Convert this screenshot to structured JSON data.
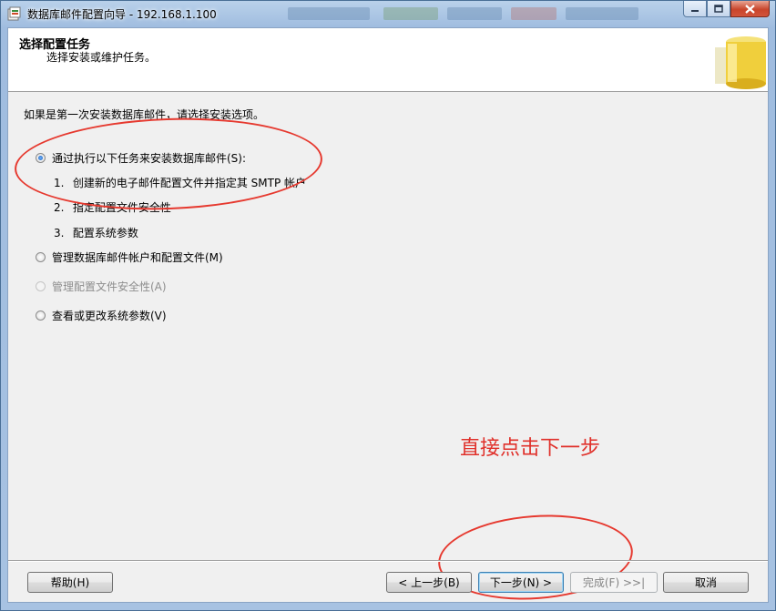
{
  "window": {
    "title": "数据库邮件配置向导 - 192.168.1.100"
  },
  "header": {
    "title": "选择配置任务",
    "subtitle": "选择安装或维护任务。"
  },
  "main": {
    "intro": "如果是第一次安装数据库邮件，请选择安装选项。",
    "options": [
      {
        "label": "通过执行以下任务来安装数据库邮件(S):",
        "checked": true,
        "enabled": true
      },
      {
        "label": "管理数据库邮件帐户和配置文件(M)",
        "checked": false,
        "enabled": true
      },
      {
        "label": "管理配置文件安全性(A)",
        "checked": false,
        "enabled": false
      },
      {
        "label": "查看或更改系统参数(V)",
        "checked": false,
        "enabled": true
      }
    ],
    "steps": [
      {
        "num": "1.",
        "text": "创建新的电子邮件配置文件并指定其 SMTP 帐户"
      },
      {
        "num": "2.",
        "text": "指定配置文件安全性"
      },
      {
        "num": "3.",
        "text": "配置系统参数"
      }
    ]
  },
  "annotation": {
    "text": "直接点击下一步",
    "color": "#e0302a"
  },
  "footer": {
    "help": "帮助(H)",
    "back": "< 上一步(B)",
    "next": "下一步(N) >",
    "finish": "完成(F) >>|",
    "cancel": "取消"
  }
}
